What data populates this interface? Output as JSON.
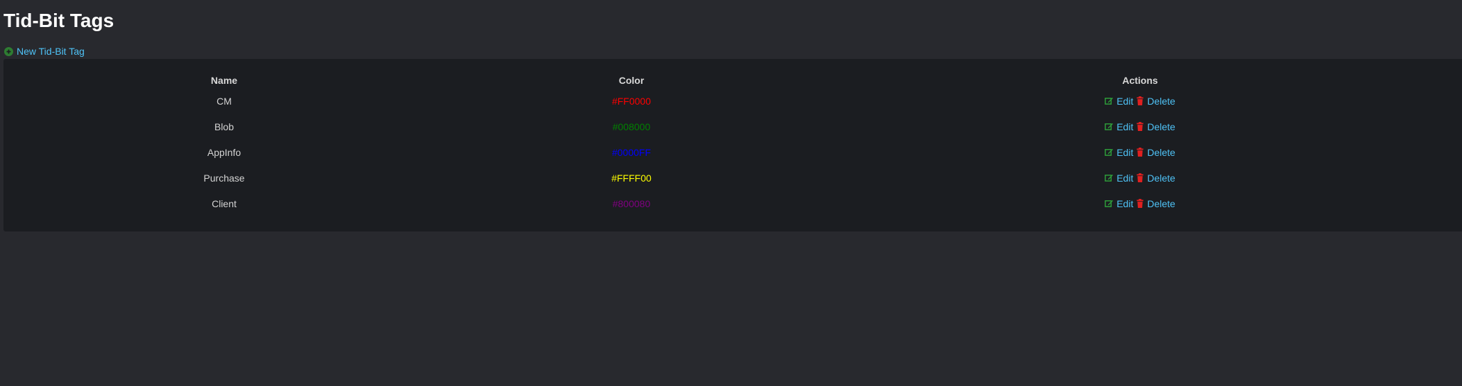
{
  "page": {
    "title": "Tid-Bit Tags",
    "new_link_label": "New Tid-Bit Tag"
  },
  "table": {
    "headers": {
      "name": "Name",
      "color": "Color",
      "actions": "Actions"
    },
    "rows": [
      {
        "name": "CM",
        "color": "#FF0000"
      },
      {
        "name": "Blob",
        "color": "#008000"
      },
      {
        "name": "AppInfo",
        "color": "#0000FF"
      },
      {
        "name": "Purchase",
        "color": "#FFFF00"
      },
      {
        "name": "Client",
        "color": "#800080"
      }
    ],
    "edit_label": "Edit",
    "delete_label": "Delete"
  },
  "icons": {
    "new": "plus-circle-icon",
    "edit": "edit-icon",
    "delete": "trash-icon"
  },
  "colors": {
    "link": "#4fc3f7",
    "edit_icon": "#2e9e3a",
    "delete_icon": "#e02020",
    "add_icon": "#2e7d32"
  }
}
